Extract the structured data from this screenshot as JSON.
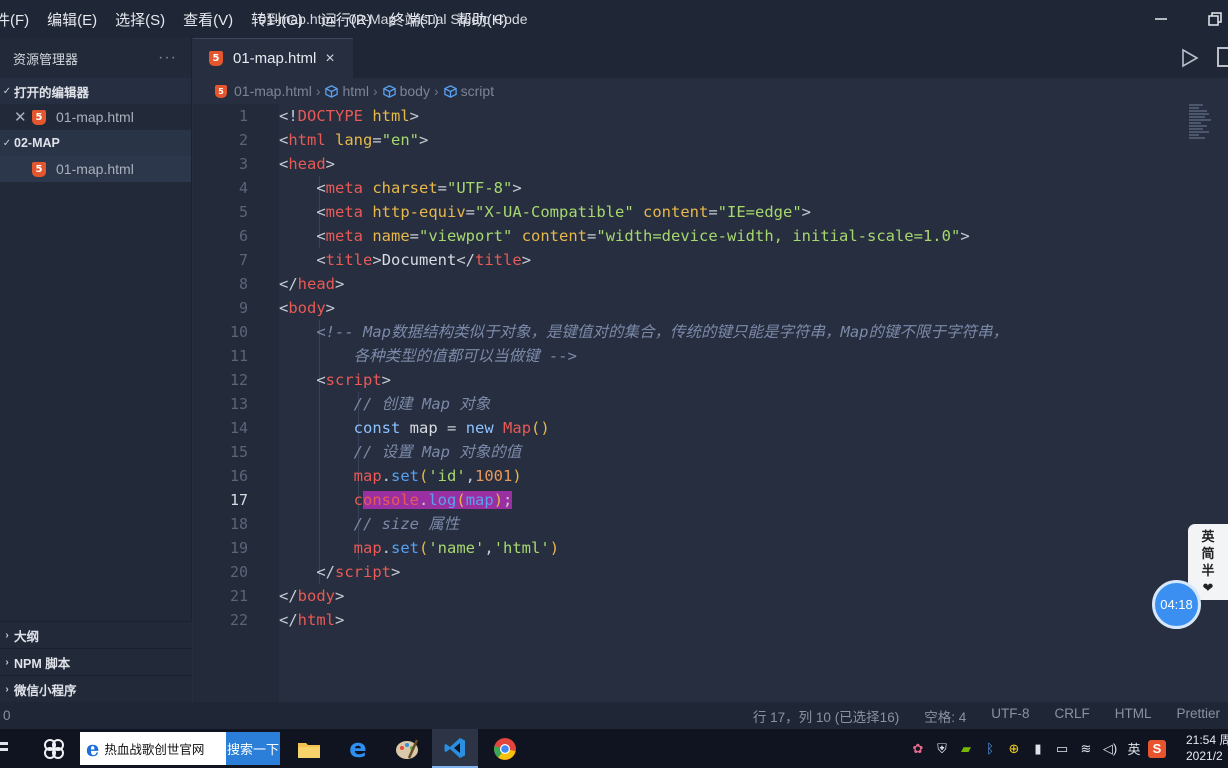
{
  "titlebar": {
    "menu": [
      "件(F)",
      "编辑(E)",
      "选择(S)",
      "查看(V)",
      "转到(G)",
      "运行(R)",
      "终端(T)",
      "帮助(H)"
    ],
    "window_title": "01-map.html - 02-Map - Visual Studio Code"
  },
  "sidebar": {
    "title": "资源管理器",
    "more": "···",
    "open_editors": {
      "heading": "打开的编辑器",
      "files": [
        {
          "name": "01-map.html",
          "icon": "html5-icon"
        }
      ]
    },
    "workspace": {
      "heading": "02-MAP",
      "files": [
        {
          "name": "01-map.html",
          "icon": "html5-icon"
        }
      ]
    },
    "bottom_sections": [
      "大纲",
      "NPM 脚本",
      "微信小程序"
    ]
  },
  "tab": {
    "label": "01-map.html",
    "close": "×"
  },
  "breadcrumb": [
    "01-map.html",
    "html",
    "body",
    "script"
  ],
  "editor": {
    "current_line": 17,
    "line_numbers": [
      "1",
      "2",
      "3",
      "4",
      "5",
      "6",
      "7",
      "8",
      "9",
      "10",
      "11",
      "12",
      "13",
      "14",
      "15",
      "16",
      "17",
      "18",
      "19",
      "20",
      "21",
      "22"
    ],
    "comment_line_10": "<!-- Map数据结构类似于对象，是键值对的集合，传统的键只能是字符串，Map的键不限于字符串，",
    "comment_line_11": "各种类型的值都可以当做键 -->",
    "comment_13": "// 创建 Map 对象",
    "comment_15": "// 设置 Map 对象的值",
    "comment_18": "// size 属性",
    "title_text": "Document"
  },
  "widgets": {
    "ime": [
      "英",
      "简",
      "半",
      "❤"
    ],
    "timer": "04:18"
  },
  "statusbar": {
    "left": "0",
    "items": [
      "行 17，列 10 (已选择16)",
      "空格: 4",
      "UTF-8",
      "CRLF",
      "HTML",
      "Prettier"
    ]
  },
  "taskbar": {
    "search_text": "热血战歌创世官网",
    "search_button": "搜索一下",
    "tray_lang": "英",
    "clock_time": "21:54 周",
    "clock_date": "2021/2"
  }
}
